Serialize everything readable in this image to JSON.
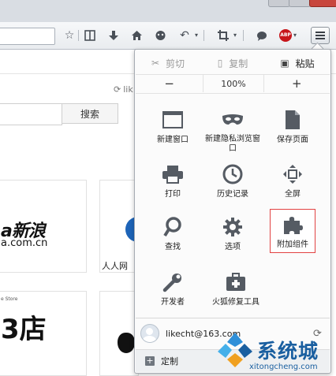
{
  "toolbar": {
    "icons": [
      "star-icon",
      "reading-list-icon",
      "download-icon",
      "home-icon",
      "chat-icon",
      "back-icon",
      "dropdown-icon",
      "crop-icon",
      "dropdown-icon",
      "bubble-icon",
      "adblock-icon",
      "menu-icon"
    ],
    "abp_text": "ABP"
  },
  "page": {
    "like_text": "lik",
    "search_button": "搜索",
    "tiles": {
      "sina_logo": "a新浪",
      "sina_url": "a.com.cn",
      "renren_label": "人人网",
      "store_small": "e Store",
      "store_logo": "3店"
    }
  },
  "menu": {
    "edit": {
      "cut": "剪切",
      "copy": "复制",
      "paste": "粘贴"
    },
    "zoom": {
      "out": "−",
      "level": "100%",
      "in": "+"
    },
    "items": [
      {
        "label": "新建窗口",
        "icon": "new-window-icon"
      },
      {
        "label": "新建隐私浏览窗口",
        "icon": "private-mask-icon"
      },
      {
        "label": "保存页面",
        "icon": "save-page-icon"
      },
      {
        "label": "打印",
        "icon": "printer-icon"
      },
      {
        "label": "历史记录",
        "icon": "clock-icon"
      },
      {
        "label": "全屏",
        "icon": "fullscreen-icon"
      },
      {
        "label": "查找",
        "icon": "magnifier-icon"
      },
      {
        "label": "选项",
        "icon": "gear-icon"
      },
      {
        "label": "附加组件",
        "icon": "puzzle-icon"
      },
      {
        "label": "开发者",
        "icon": "wrench-icon"
      },
      {
        "label": "火狐修复工具",
        "icon": "toolbox-icon"
      }
    ],
    "account_email": "likecht@163.com",
    "customize": "定制"
  },
  "watermark": {
    "text": "系统城",
    "url": "xitongcheng.com"
  },
  "colors": {
    "highlight_border": "#e24242",
    "icon_gray": "#555b63",
    "watermark_blue": "#1a5fa0"
  }
}
